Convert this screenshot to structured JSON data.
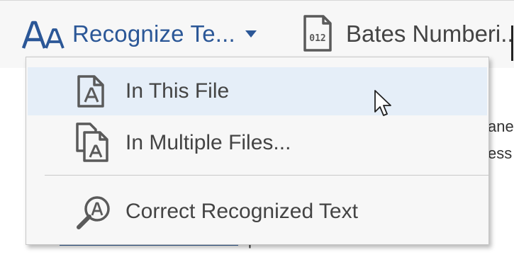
{
  "toolbar": {
    "recognize_label": "Recognize Te...",
    "bates_label": "Bates Numberi...",
    "bates_icon_text": "012"
  },
  "document": {
    "line1": "ane",
    "line2": "ess",
    "line3": "p"
  },
  "menu": {
    "items": [
      {
        "label": "In This File",
        "icon": "single-file-text-icon",
        "highlighted": true
      },
      {
        "label": "In Multiple Files...",
        "icon": "multiple-files-text-icon"
      },
      {
        "label": "Correct Recognized Text",
        "icon": "magnifier-text-icon"
      }
    ]
  },
  "colors": {
    "accent": "#2b5797",
    "highlight": "#e5eef8",
    "menu_bg": "#f7f7f7",
    "text": "#444444"
  }
}
